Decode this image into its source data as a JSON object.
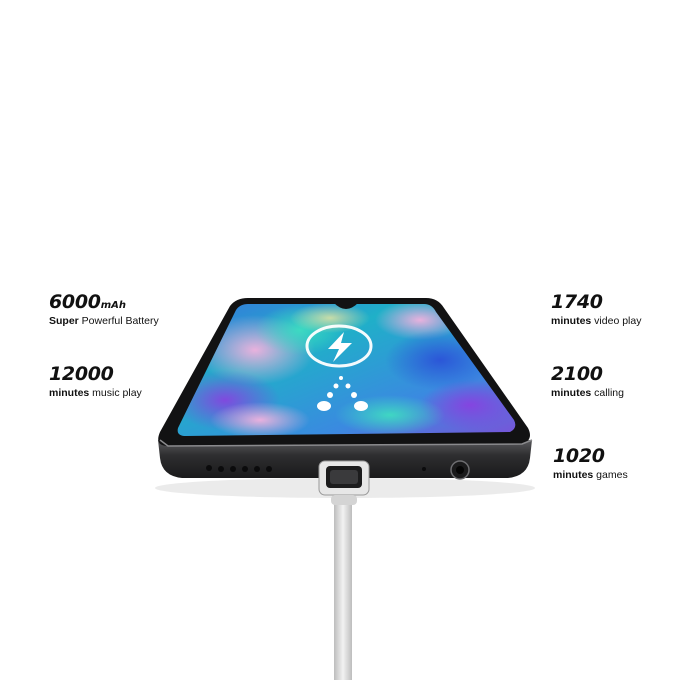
{
  "specs": {
    "battery": {
      "value": "6000",
      "unit": "mAh",
      "desc_bold": "Super",
      "desc_rest": " Powerful Battery"
    },
    "music": {
      "value": "12000",
      "desc_bold": "minutes",
      "desc_rest": " music play"
    },
    "video": {
      "value": "1740",
      "desc_bold": "minutes",
      "desc_rest": " video play"
    },
    "calling": {
      "value": "2100",
      "desc_bold": "minutes",
      "desc_rest": " calling"
    },
    "games": {
      "value": "1020",
      "desc_bold": "minutes",
      "desc_rest": " games"
    }
  },
  "illustration": {
    "screen_icon": "lightning-bolt-icon",
    "connector": "usb-charging-cable",
    "colors": {
      "phone_body": "#3b3b3d",
      "screen_blue": "#2a7fd0",
      "screen_teal": "#1fb7b0",
      "screen_purple": "#7d4bd6",
      "screen_pink": "#e9a1d6",
      "cable": "#d9d9d9"
    }
  }
}
